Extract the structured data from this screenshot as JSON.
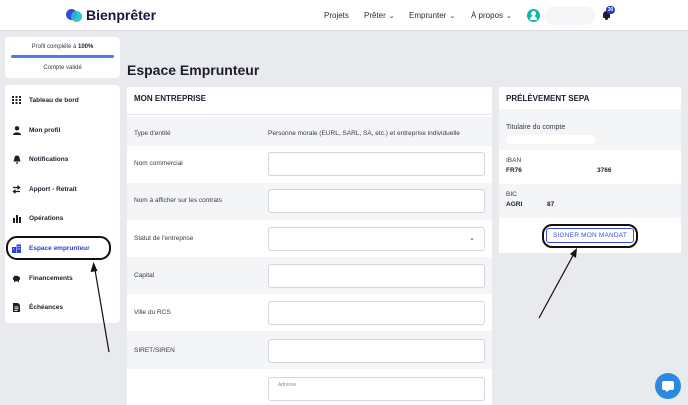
{
  "brand": {
    "name": "Bienprêter"
  },
  "nav": {
    "items": [
      {
        "label": "Projets",
        "chevron": false
      },
      {
        "label": "Prêter",
        "chevron": true
      },
      {
        "label": "Emprunter",
        "chevron": true
      },
      {
        "label": "À propos",
        "chevron": true
      }
    ],
    "notification_count": "30"
  },
  "profile": {
    "completion_prefix": "Profil complété à",
    "completion_value": "100%",
    "completion_fraction": 1.0,
    "status": "Compte validé"
  },
  "sidebar": {
    "items": [
      {
        "label": "Tableau de bord",
        "icon": "grid-icon",
        "active": false
      },
      {
        "label": "Mon profil",
        "icon": "user-icon",
        "active": false
      },
      {
        "label": "Notifications",
        "icon": "bell-icon",
        "active": false
      },
      {
        "label": "Apport - Retrait",
        "icon": "transfer-icon",
        "active": false
      },
      {
        "label": "Opérations",
        "icon": "bar-chart-icon",
        "active": false
      },
      {
        "label": "Espace emprunteur",
        "icon": "building-icon",
        "active": true
      },
      {
        "label": "Financements",
        "icon": "piggy-bank-icon",
        "active": false
      },
      {
        "label": "Échéances",
        "icon": "document-icon",
        "active": false
      }
    ]
  },
  "page": {
    "title": "Espace Emprunteur"
  },
  "entreprise": {
    "title": "MON ENTREPRISE",
    "rows": [
      {
        "label": "Type d'entité",
        "value": "Personne morale (EURL, SARL, SA, etc.) et entreprise individuelle"
      },
      {
        "label": "Nom commercial",
        "value": ""
      },
      {
        "label": "Nom à afficher sur les contrats",
        "value": ""
      },
      {
        "label": "Statut de l'entreprise",
        "value": ""
      },
      {
        "label": "Capital",
        "value": ""
      },
      {
        "label": "Ville du RCS",
        "value": ""
      },
      {
        "label": "SIRET/SIREN",
        "value": ""
      },
      {
        "label": "",
        "value": "",
        "placeholder": "Adresse"
      }
    ]
  },
  "sepa": {
    "title": "PRÉLÈVEMENT SEPA",
    "holder_label": "Titulaire du compte",
    "iban_label": "IBAN",
    "iban_start": "FR76",
    "iban_end": "3766",
    "bic_label": "BIC",
    "bic_start": "AGRI",
    "bic_end": "87",
    "sign_button": "SIGNER MON MANDAT"
  },
  "colors": {
    "accent": "#2b3fd0",
    "teal": "#13b5a7",
    "chat": "#2b8ae0",
    "background": "#e9eaee"
  }
}
